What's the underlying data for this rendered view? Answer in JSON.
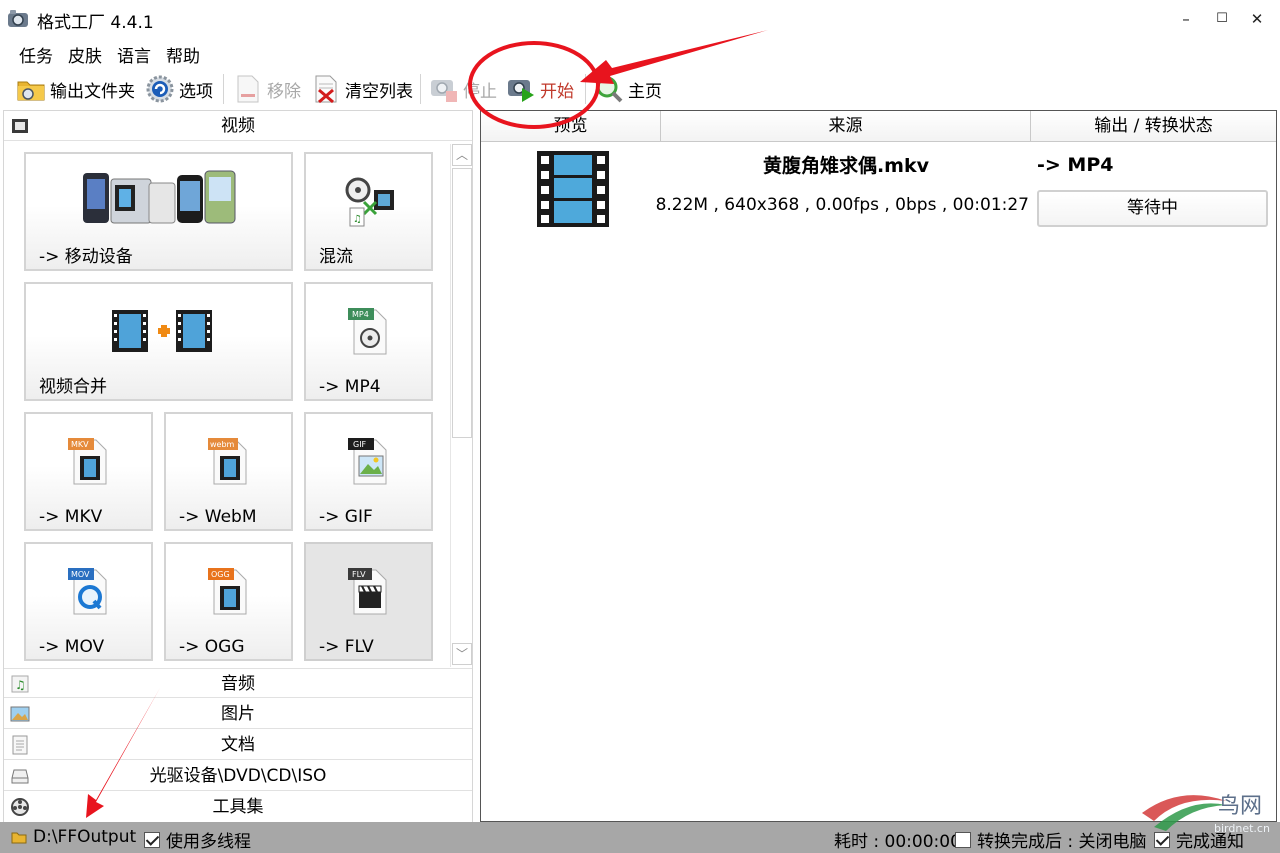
{
  "window": {
    "title": "格式工厂 4.4.1",
    "minimize": "–",
    "maximize": "☐",
    "close": "✕"
  },
  "menu": [
    "任务",
    "皮肤",
    "语言",
    "帮助"
  ],
  "toolbar": {
    "output_folder": "输出文件夹",
    "options": "选项",
    "remove": "移除",
    "clear_list": "清空列表",
    "stop": "停止",
    "start": "开始",
    "home": "主页"
  },
  "left": {
    "video_header": "视频",
    "tiles": [
      {
        "label": "-> 移动设备",
        "icon": "mobile-devices-icon"
      },
      {
        "label": "混流",
        "icon": "mux-icon"
      },
      {
        "label": "视频合并",
        "icon": "video-join-icon"
      },
      {
        "label": "-> MP4",
        "icon": "mp4-file-icon",
        "badge": "MP4"
      },
      {
        "label": "-> MKV",
        "icon": "mkv-file-icon",
        "badge": "MKV"
      },
      {
        "label": "-> WebM",
        "icon": "webm-file-icon",
        "badge": "webm"
      },
      {
        "label": "-> GIF",
        "icon": "gif-file-icon",
        "badge": "GIF"
      },
      {
        "label": "-> MOV",
        "icon": "mov-file-icon",
        "badge": "MOV"
      },
      {
        "label": "-> OGG",
        "icon": "ogg-file-icon",
        "badge": "OGG"
      },
      {
        "label": "-> FLV",
        "icon": "flv-file-icon",
        "badge": "FLV"
      }
    ],
    "categories": [
      "音频",
      "图片",
      "文档",
      "光驱设备\\DVD\\CD\\ISO",
      "工具集"
    ]
  },
  "task_list": {
    "columns": [
      "预览",
      "来源",
      "输出 / 转换状态"
    ],
    "rows": [
      {
        "filename": "黄腹角雉求偶.mkv",
        "info": "8.22M , 640x368 , 0.00fps , 0bps , 00:01:27",
        "target": "-> MP4",
        "status": "等待中"
      }
    ]
  },
  "statusbar": {
    "output_path": "D:\\FFOutput",
    "multithread_label": "使用多线程",
    "multithread_checked": true,
    "elapsed": "耗时 : 00:00:00",
    "after_done_label": "转换完成后 : 关闭电脑",
    "after_done_checked": false,
    "notify_label": "完成通知",
    "notify_checked": true
  },
  "watermark": {
    "text": "鸟网",
    "sub": "birdnet.cn"
  },
  "colors": {
    "annotation_red": "#e8141e",
    "start_text": "#c0392b",
    "statusbar_bg": "#a7a7a7"
  }
}
